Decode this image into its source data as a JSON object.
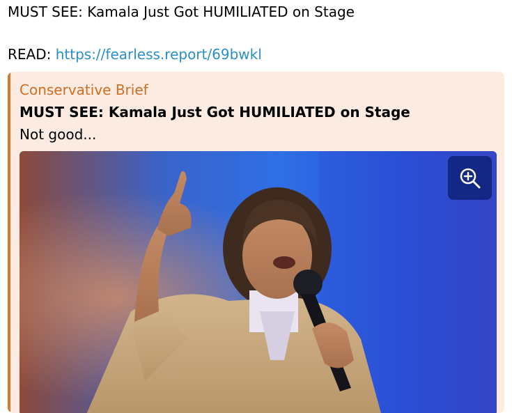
{
  "message": {
    "title": "MUST SEE: Kamala Just Got HUMILIATED on Stage",
    "read_prefix": "READ: ",
    "link_text": "https://fearless.report/69bwkl"
  },
  "preview": {
    "site_name": "Conservative Brief",
    "title": "MUST SEE: Kamala Just Got HUMILIATED on Stage",
    "description": "Not good...",
    "image_icon": "photo",
    "zoom_icon": "zoom-in-icon",
    "accent_color": "#d9772c",
    "background_color": "#fbebe1"
  }
}
